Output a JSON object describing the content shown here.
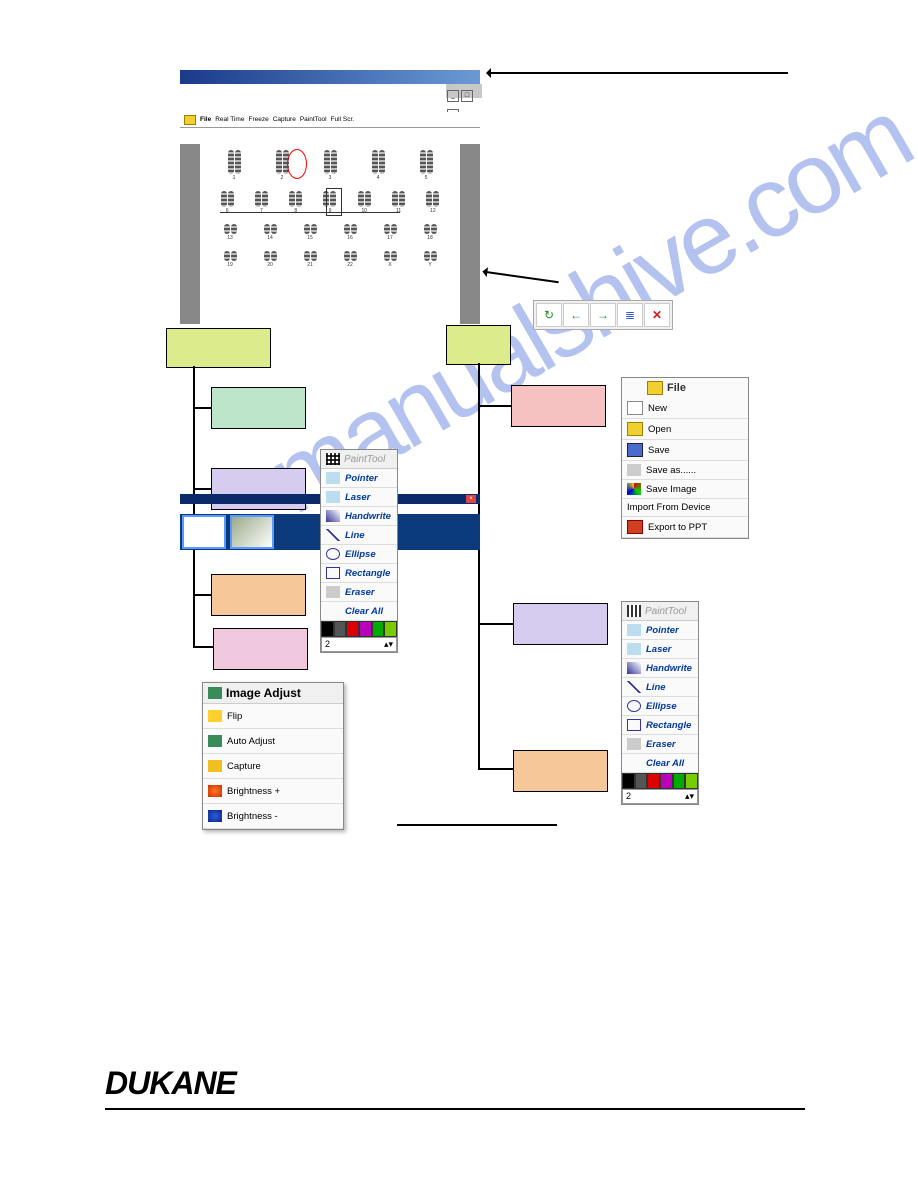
{
  "brand": "DUKANE",
  "watermark": "manualshive.com",
  "app_toolbar": {
    "file": "File",
    "realtime": "Real Time",
    "freeze": "Freeze",
    "capture": "Capture",
    "painttool": "PaintTool",
    "fullscr": "Full Scr."
  },
  "chromosomes": {
    "row1": [
      "1",
      "2",
      "3",
      "4",
      "5"
    ],
    "row2": [
      "6",
      "7",
      "8",
      "9",
      "10",
      "11",
      "12"
    ],
    "row3": [
      "13",
      "14",
      "15",
      "16",
      "17",
      "18"
    ],
    "row4": [
      "19",
      "20",
      "21",
      "22",
      "X",
      "Y"
    ]
  },
  "small_toolbar": {
    "refresh": "↻",
    "back": "←",
    "fwd": "→",
    "list": "≣",
    "close": "✕"
  },
  "paint_tool": {
    "title": "PaintTool",
    "items": [
      "Pointer",
      "Laser",
      "Handwrite",
      "Line",
      "Ellipse",
      "Rectangle",
      "Eraser",
      "Clear All"
    ],
    "colors": [
      "#000",
      "#666",
      "#d00",
      "#b0b",
      "#0a0",
      "#7c0",
      "#000",
      "#630",
      "#d0d",
      "#d00",
      "#0cc",
      "#0d0"
    ],
    "width": "2"
  },
  "file_menu": {
    "title": "File",
    "items": [
      "New",
      "Open",
      "Save",
      "Save as......",
      "Save Image",
      "Import From Device",
      "Export to PPT"
    ]
  },
  "image_adjust": {
    "title": "Image Adjust",
    "items": [
      "Flip",
      "Auto Adjust",
      "Capture",
      "Brightness +",
      "Brightness -"
    ]
  }
}
